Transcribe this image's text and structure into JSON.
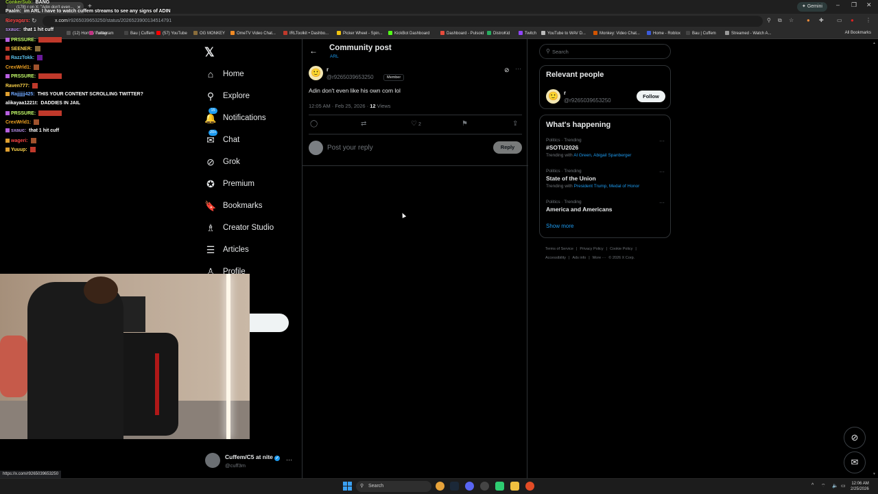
{
  "browser": {
    "tab_title": "(178) r on X: \"Adin don't even...",
    "gemini_label": "Gemini",
    "url_host": "x.com",
    "url_path": "/r9265039653250/status/2026523900134514791",
    "bookmarks": [
      {
        "label": "(12) Home / Twitter",
        "color": "#555555"
      },
      {
        "label": "Instagram",
        "color": "#c13584"
      },
      {
        "label": "Bau | Cuffem",
        "color": "#444444"
      },
      {
        "label": "(57) YouTube",
        "color": "#ff0000"
      },
      {
        "label": "OG MONKEY",
        "color": "#8a6d3b"
      },
      {
        "label": "OmeTV Video Chat...",
        "color": "#f08a24"
      },
      {
        "label": "IRLToolkit • Dashbo...",
        "color": "#c0392b"
      },
      {
        "label": "Picker Wheel - Spin...",
        "color": "#f1c40f"
      },
      {
        "label": "KickBot Dashboard",
        "color": "#53fc18"
      },
      {
        "label": "Dashboard - Pulsoid",
        "color": "#e74c3c"
      },
      {
        "label": "DistroKid",
        "color": "#27ae60"
      },
      {
        "label": "Twitch",
        "color": "#9146ff"
      },
      {
        "label": "YouTube to WAV D...",
        "color": "#bbbbbb"
      },
      {
        "label": "Monkey: Video Chat...",
        "color": "#d35400"
      },
      {
        "label": "Home - Roblox",
        "color": "#3b5bdb"
      },
      {
        "label": "Bau | Cuffem",
        "color": "#444444"
      },
      {
        "label": "Streamed - Watch A...",
        "color": "#999999"
      }
    ],
    "all_bookmarks": "All Bookmarks",
    "status_url": "https://x.com/r9265039653250"
  },
  "sidebar": {
    "items": [
      {
        "label": "Home",
        "icon": "home-icon",
        "glyph": "⌂"
      },
      {
        "label": "Explore",
        "icon": "search-icon",
        "glyph": "⚲"
      },
      {
        "label": "Notifications",
        "icon": "bell-icon",
        "glyph": "🔔",
        "badge": "15"
      },
      {
        "label": "Chat",
        "icon": "mail-icon",
        "glyph": "✉",
        "badge": "20+"
      },
      {
        "label": "Grok",
        "icon": "grok-icon",
        "glyph": "⊘"
      },
      {
        "label": "Premium",
        "icon": "premium-icon",
        "glyph": "✪"
      },
      {
        "label": "Bookmarks",
        "icon": "bookmark-icon",
        "glyph": "🔖"
      },
      {
        "label": "Creator Studio",
        "icon": "creator-studio-icon",
        "glyph": "♗"
      },
      {
        "label": "Articles",
        "icon": "articles-icon",
        "glyph": "☰"
      },
      {
        "label": "Profile",
        "icon": "profile-icon",
        "glyph": "♙"
      }
    ],
    "post_button": "t",
    "account": {
      "name": "Cuffem/C5 at nite",
      "handle": "@cuff3m"
    }
  },
  "main": {
    "header_title": "Community post",
    "header_sub": "ARL",
    "post": {
      "name": "r",
      "handle": "@r9265039653250",
      "member_badge": "Member",
      "text": "Adin don't even like his own com lol",
      "time": "12:05 AM · Feb 25, 2026 · ",
      "views_count": "12",
      "views_label": " Views",
      "likes": "2"
    },
    "reply_placeholder": "Post your reply",
    "reply_button": "Reply"
  },
  "right": {
    "search_placeholder": "Search",
    "relevant_title": "Relevant people",
    "relevant_person": {
      "name": "r",
      "handle": "@r9265039653250",
      "follow": "Follow"
    },
    "happening_title": "What's happening",
    "trends": [
      {
        "category": "Politics · Trending",
        "name": "#SOTU2026",
        "with_prefix": "Trending with ",
        "with": "Al Green, Abigail Spanberger"
      },
      {
        "category": "Politics · Trending",
        "name": "State of the Union",
        "with_prefix": "Trending with ",
        "with": "President Trump, Medal of Honor"
      },
      {
        "category": "Politics · Trending",
        "name": "America and Americans",
        "with_prefix": "",
        "with": ""
      }
    ],
    "show_more": "Show more",
    "footer_line1": [
      "Terms of Service",
      "|",
      "Privacy Policy",
      "|",
      "Cookie Policy",
      "|"
    ],
    "footer_line2": [
      "Accessibility",
      "|",
      "Ads info",
      "|",
      "More ···",
      "© 2026 X Corp."
    ]
  },
  "chat": [
    {
      "user": "ConkerSub:",
      "msg": " BANG",
      "color": "#9acd32",
      "badge": ""
    },
    {
      "user": "Paalm:",
      "msg": " im ARL I have to watch cuffem streams to see any signs of ADIN",
      "color": "#ffffff",
      "badge": ""
    },
    {
      "user": "Rieyagers:",
      "msg": "",
      "color": "#ff4444",
      "badge": ""
    },
    {
      "user": "sxauc:",
      "msg": " that 1 hit cuff",
      "color": "#b48ee6",
      "badge": ""
    },
    {
      "user": "PRSSURE:",
      "msg": "",
      "color": "#c6ff6b",
      "badge": "#b75fe0",
      "emote": "#c0392b"
    },
    {
      "user": "SEENER:",
      "msg": "",
      "color": "#ffd54a",
      "badge": "#c0392b",
      "emote": "#8a6d3b"
    },
    {
      "user": "RazzTokk:",
      "msg": "",
      "color": "#5bc0eb",
      "badge": "#c0392b",
      "emote": "#6a1b9a"
    },
    {
      "user": "CrexWrld1:",
      "msg": "",
      "color": "#f5a623",
      "badge": "",
      "emote": "#a0522d"
    },
    {
      "user": "PRSSURE:",
      "msg": "",
      "color": "#c6ff6b",
      "badge": "#b75fe0",
      "emote": "#c0392b"
    },
    {
      "user": "Raven777:",
      "msg": "",
      "color": "#ffd54a",
      "badge": "",
      "emote": "#c0392b"
    },
    {
      "user": "Rajjjjjj425:",
      "msg": " THIS YOUR CONTENT SCROLLING TWITTER?",
      "color": "#6fa8ff",
      "badge": "#e0a030"
    },
    {
      "user": "alikayaa1221t:",
      "msg": " DADDIES IN JAIL",
      "color": "#ffffff",
      "badge": ""
    },
    {
      "user": "PRSSURE:",
      "msg": "",
      "color": "#c6ff6b",
      "badge": "#b75fe0",
      "emote": "#c0392b"
    },
    {
      "user": "CrexWrld1:",
      "msg": "",
      "color": "#f5a623",
      "badge": "",
      "emote": "#a0522d"
    },
    {
      "user": "sxauc:",
      "msg": " that 1 hit cuff",
      "color": "#b48ee6",
      "badge": "#b75fe0"
    },
    {
      "user": "wageri:",
      "msg": "",
      "color": "#ff4444",
      "badge": "#e0a030",
      "emote": "#a0522d"
    },
    {
      "user": "Yuuup:",
      "msg": "",
      "color": "#ffd54a",
      "badge": "#e0a030",
      "emote": "#c0392b"
    }
  ],
  "taskbar": {
    "search_label": "Search",
    "time": "12:06 AM",
    "date": "2/25/2026"
  }
}
